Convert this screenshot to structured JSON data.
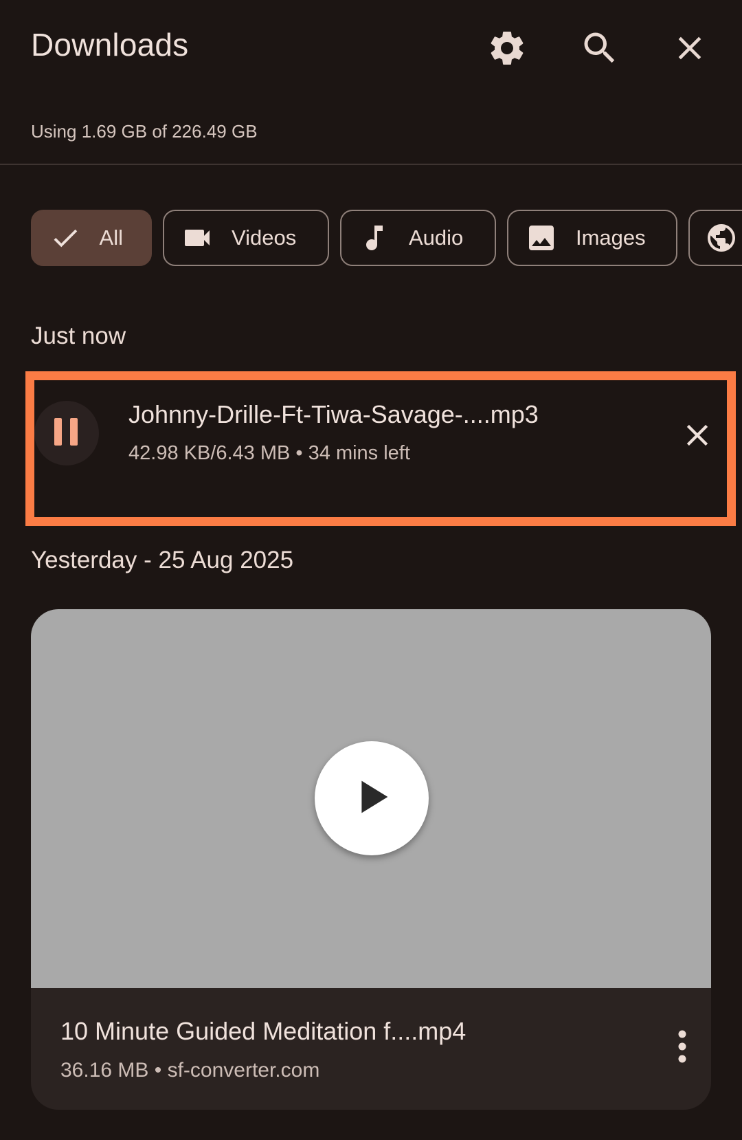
{
  "header": {
    "title": "Downloads",
    "icons": [
      "settings-icon",
      "search-icon",
      "close-icon"
    ]
  },
  "storage": {
    "text": "Using 1.69 GB of 226.49 GB"
  },
  "filters": {
    "chips": [
      {
        "label": "All",
        "icon": "check-icon",
        "selected": true
      },
      {
        "label": "Videos",
        "icon": "video-icon",
        "selected": false
      },
      {
        "label": "Audio",
        "icon": "music-note-icon",
        "selected": false
      },
      {
        "label": "Images",
        "icon": "image-icon",
        "selected": false
      },
      {
        "label": "",
        "icon": "globe-icon",
        "selected": false
      }
    ]
  },
  "sections": {
    "recent": "Just now",
    "yesterday": "Yesterday - 25 Aug 2025"
  },
  "active_download": {
    "file_name": "Johnny-Drille-Ft-Tiwa-Savage-....mp3",
    "status": "42.98 KB/6.43 MB • 34 mins left",
    "icon": "pause-icon",
    "highlight_color": "#fb7c45"
  },
  "video_item": {
    "file_name": "10 Minute Guided Meditation f....mp4",
    "details": "36.16 MB • sf-converter.com",
    "thumbnail_color": "#a9a9a9",
    "icon": "play-icon"
  },
  "colors": {
    "background": "#1c1513",
    "accent_chip": "#5b4037",
    "pause_accent": "#f6a686"
  }
}
